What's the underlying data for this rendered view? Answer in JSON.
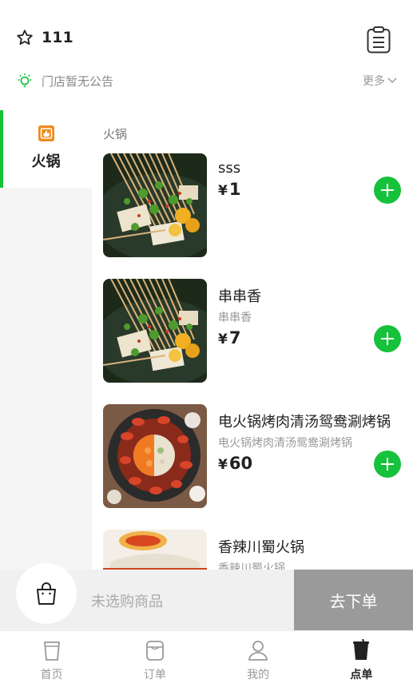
{
  "header": {
    "shop_name": "111",
    "notice": "门店暂无公告",
    "more_label": "更多"
  },
  "sidebar": {
    "categories": [
      {
        "label": "火锅",
        "active": true
      }
    ]
  },
  "main": {
    "section_title": "火锅",
    "currency": "¥",
    "products": [
      {
        "name": "sss",
        "desc": "",
        "price": "1"
      },
      {
        "name": "串串香",
        "desc": "串串香",
        "price": "7"
      },
      {
        "name": "电火锅烤肉清汤鸳鸯涮烤锅",
        "desc": "电火锅烤肉清汤鸳鸯涮烤锅",
        "price": "60"
      },
      {
        "name": "香辣川蜀火锅",
        "desc": "香辣川蜀火锅",
        "price": ""
      }
    ]
  },
  "cart": {
    "empty_text": "未选购商品",
    "checkout_label": "去下单"
  },
  "tabbar": {
    "tabs": [
      {
        "label": "首页",
        "icon": "cup-icon",
        "active": false
      },
      {
        "label": "订单",
        "icon": "order-icon",
        "active": false
      },
      {
        "label": "我的",
        "icon": "user-icon",
        "active": false
      },
      {
        "label": "点单",
        "icon": "cup-filled-icon",
        "active": true
      }
    ]
  },
  "colors": {
    "accent": "#16c13b",
    "checkout_disabled": "#9a9a9a",
    "category_icon": "#f08a1d"
  }
}
